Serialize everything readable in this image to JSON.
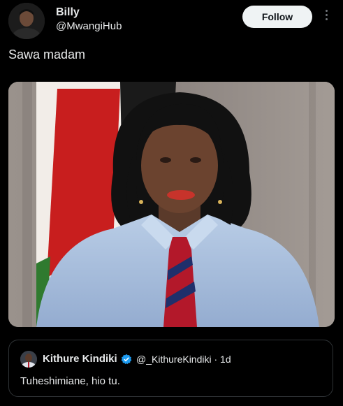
{
  "author": {
    "name": "Billy",
    "handle": "@MwangiHub"
  },
  "follow_label": "Follow",
  "post_text": "Sawa madam",
  "quoted": {
    "name": "Kithure Kindiki",
    "handle_time": "@_KithureKindiki · 1d",
    "text": "Tuheshimiane, hio tu."
  },
  "colors": {
    "background": "#000000",
    "follow_bg": "#eff3f4",
    "verified": "#1d9bf0"
  }
}
